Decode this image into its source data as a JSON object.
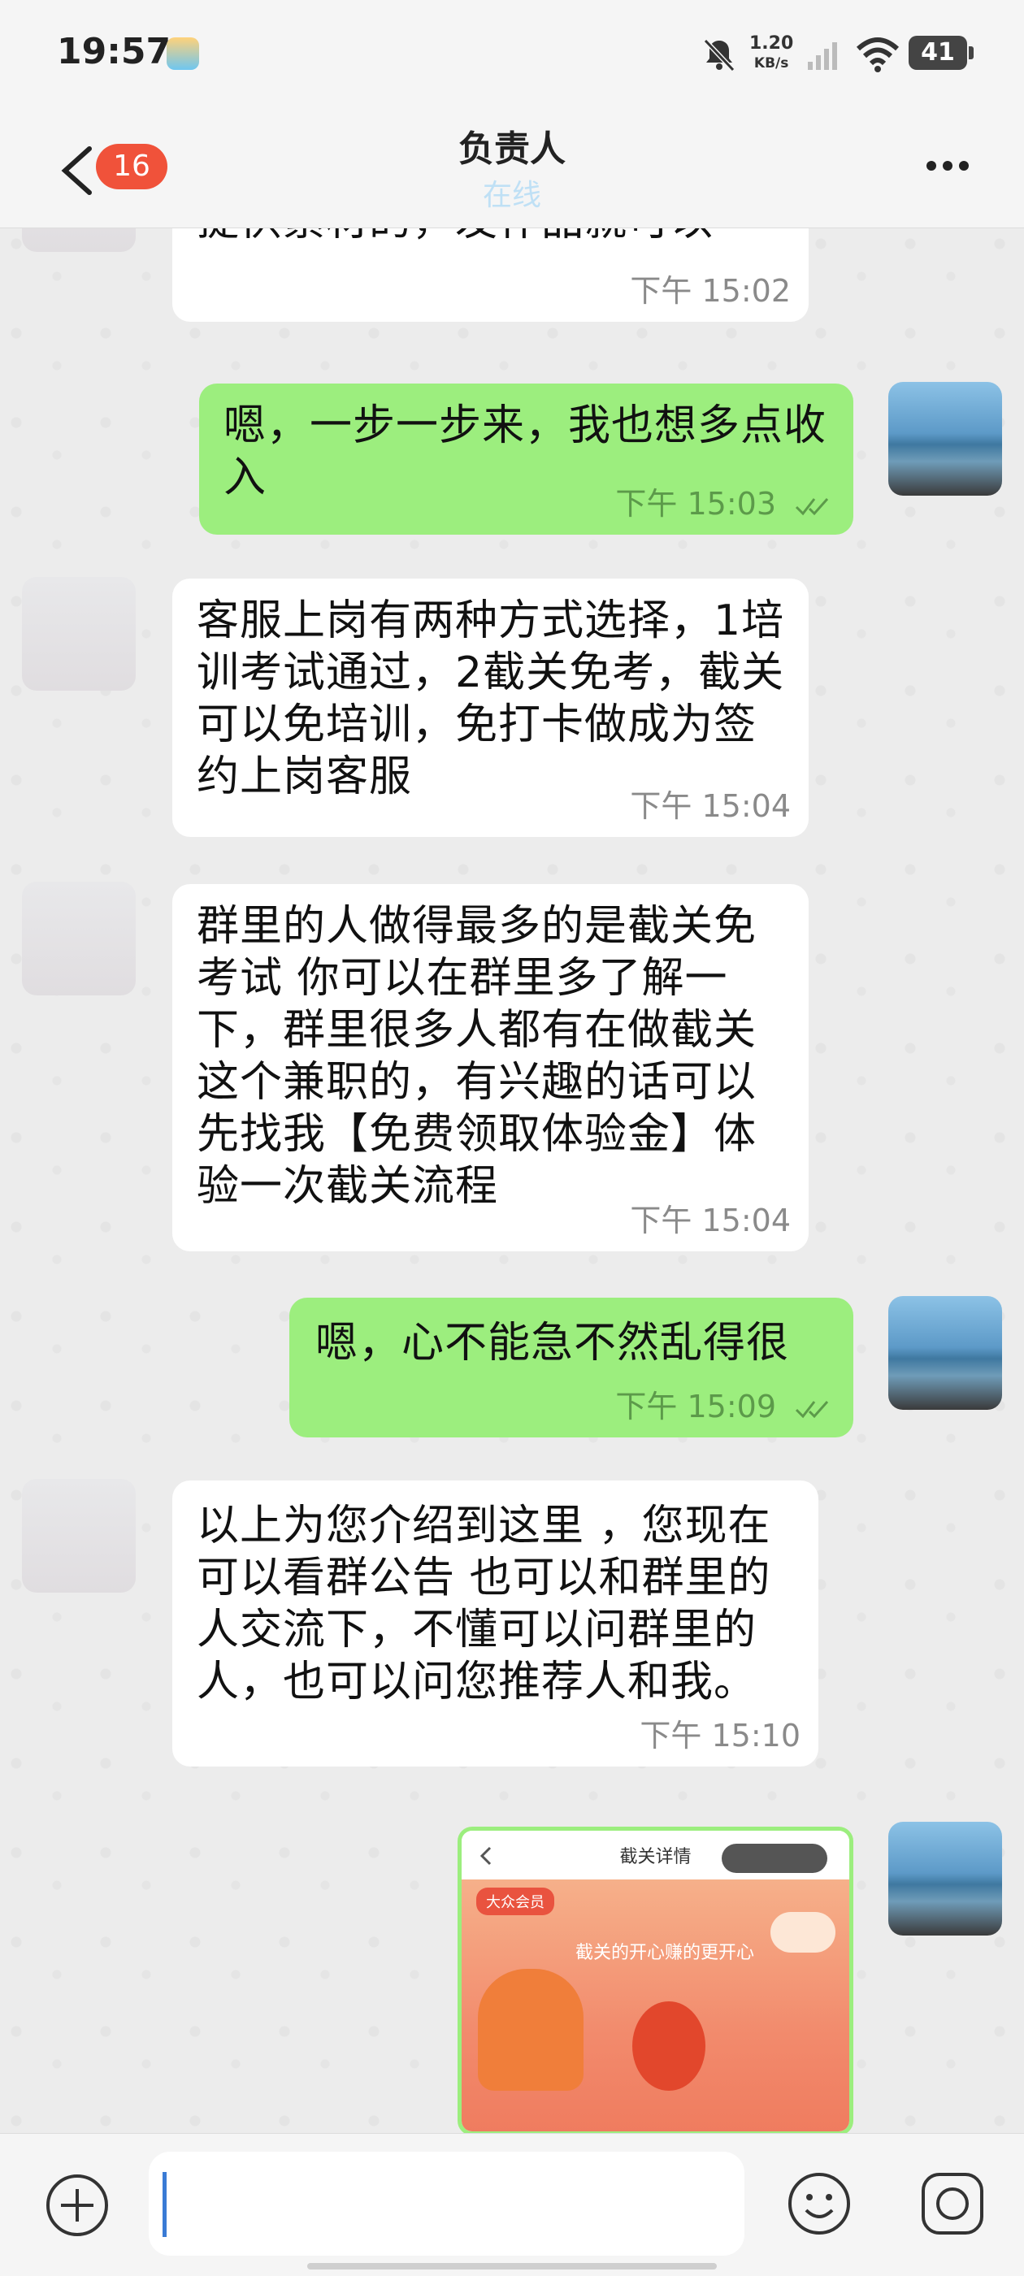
{
  "status_bar": {
    "time": "19:57",
    "net_rate": "1.20",
    "net_unit": "KB/s",
    "battery": "41"
  },
  "header": {
    "back_badge": "16",
    "title": "负责人",
    "status": "在线"
  },
  "messages": [
    {
      "side": "in",
      "text": "提供素材的，发作品就可以",
      "time": "下午 15:02"
    },
    {
      "side": "out",
      "text": "嗯，一步一步来，我也想多点收入",
      "time": "下午 15:03"
    },
    {
      "side": "in",
      "text": "客服上岗有两种方式选择，1培训考试通过，2截关免考，截关可以免培训，免打卡做成为签约上岗客服",
      "time": "下午 15:04"
    },
    {
      "side": "in",
      "text": "群里的人做得最多的是截关免考试 你可以在群里多了解一下，群里很多人都有在做截关这个兼职的，有兴趣的话可以先找我【免费领取体验金】体验一次截关流程",
      "time": "下午 15:04"
    },
    {
      "side": "out",
      "text": "嗯，心不能急不然乱得很",
      "time": "下午 15:09"
    },
    {
      "side": "in",
      "text": "以上为您介绍到这里 ，您现在可以看群公告 也可以和群里的人交流下，不懂可以问群里的人，也可以问您推荐人和我。",
      "time": "下午 15:10"
    }
  ],
  "image_message": {
    "title": "截关详情",
    "tag": "大众会员",
    "caption": "截关的开心赚的更开心"
  },
  "colors": {
    "outgoing_bubble": "#9cee7e",
    "incoming_bubble": "#ffffff",
    "badge": "#f0523a",
    "caret": "#3a7bd5"
  }
}
